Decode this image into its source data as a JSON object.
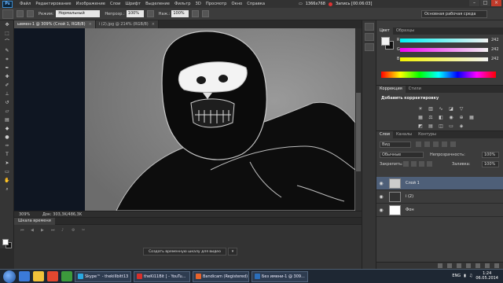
{
  "menubar": {
    "logo": "Ps",
    "items": [
      "Файл",
      "Редактирование",
      "Изображение",
      "Слои",
      "Шрифт",
      "Выделение",
      "Фильтр",
      "3D",
      "Просмотр",
      "Окно",
      "Справка"
    ],
    "resolution": "1366x768",
    "recording": "Запись [00:06:03]"
  },
  "options": {
    "mode_label": "Режим:",
    "mode_value": "Нормальный",
    "opacity_label": "Непрозр.:",
    "opacity_value": "100%",
    "flow_label": "Наж.:",
    "flow_value": "100%",
    "workspace": "Основная рабочая среда"
  },
  "doc_tabs": [
    {
      "label": "ывмен-1 @ 309% (Слой 1, RGB/8)",
      "active": true
    },
    {
      "label": "i (2).jpg @ 214% (RGB/8)",
      "active": false
    }
  ],
  "status": {
    "zoom": "309%",
    "doc": "Док: 303,3K/486,3K"
  },
  "timeline": {
    "tab": "Шкала времени",
    "create_button": "Создать временную шкалу для видео",
    "dropdown": "▾"
  },
  "color_panel": {
    "tabs": [
      "Цвет",
      "Образцы"
    ],
    "channels": [
      {
        "label": "R",
        "value": "242"
      },
      {
        "label": "G",
        "value": "242"
      },
      {
        "label": "B",
        "value": "242"
      }
    ]
  },
  "adjustments": {
    "tabs": [
      "Коррекция",
      "Стили"
    ],
    "title": "Добавить корректировку"
  },
  "layers_panel": {
    "tabs": [
      "Слои",
      "Каналы",
      "Контуры"
    ],
    "filter": "Вид",
    "blend_mode": "Обычные",
    "opacity_label": "Непрозрачность:",
    "opacity_value": "100%",
    "lock_label": "Закрепить:",
    "fill_label": "Заливка:",
    "fill_value": "100%",
    "layers": [
      {
        "name": "Слой 1",
        "selected": true
      },
      {
        "name": "i (2)",
        "selected": false
      },
      {
        "name": "Фон",
        "selected": false
      }
    ]
  },
  "taskbar": {
    "tasks": [
      {
        "label": "Skype™ - thekillbitt13",
        "color": "#29a8e0"
      },
      {
        "label": "theKi11Bit [ - YouTu...",
        "color": "#d8302b"
      },
      {
        "label": "Bandicam (Registered)",
        "color": "#e8642c"
      },
      {
        "label": "Без имени-1 @ 309...",
        "color": "#2b6fbb"
      }
    ],
    "lang": "ENG",
    "time": "1:24",
    "date": "06.05.2014"
  }
}
